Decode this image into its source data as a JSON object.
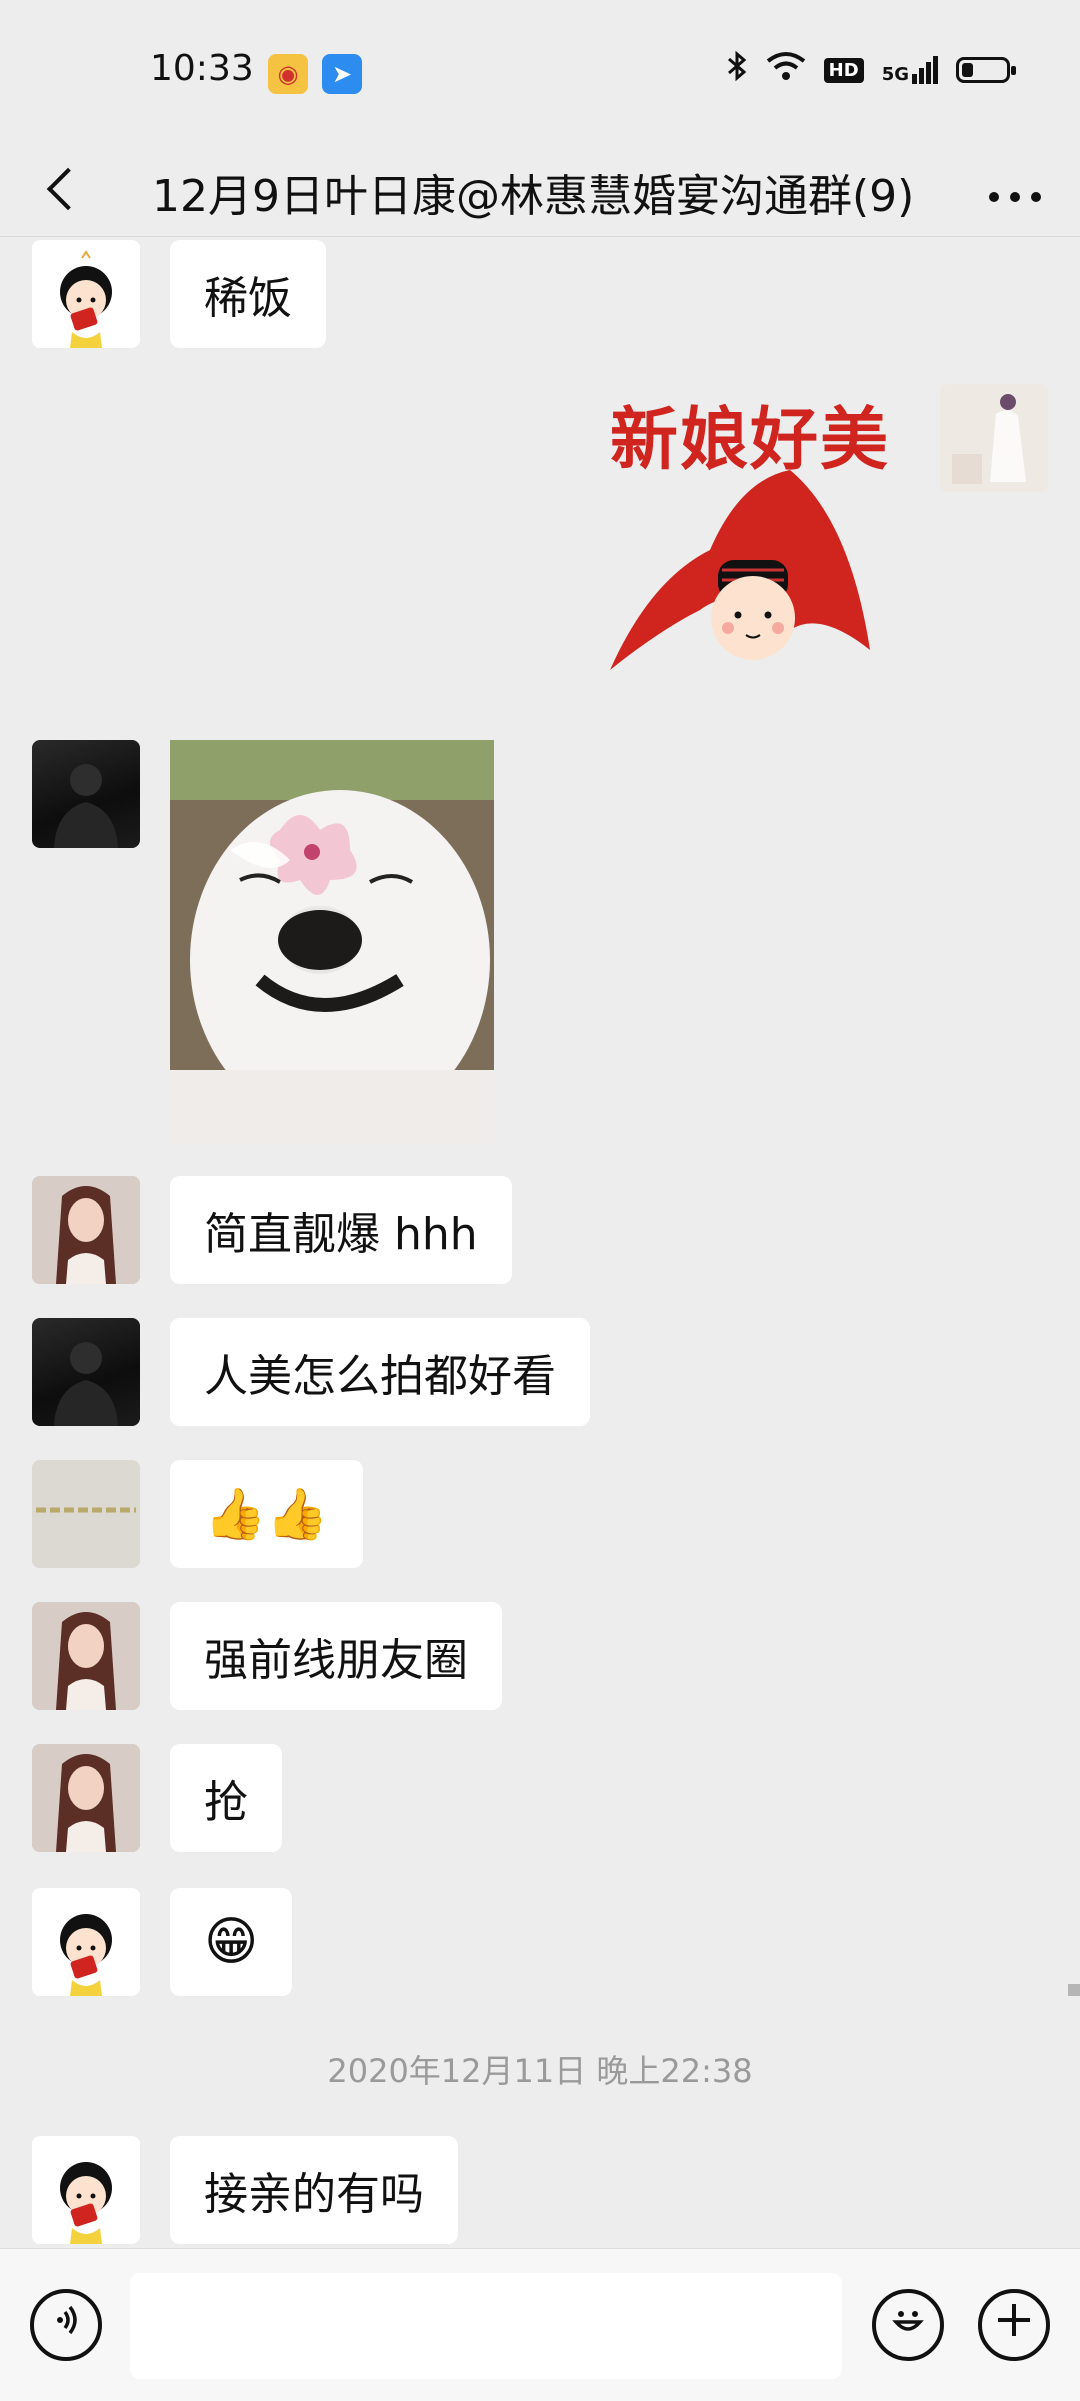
{
  "status_bar": {
    "time": "10:33",
    "icons": [
      "weibo-icon",
      "message-app-icon",
      "bluetooth-icon",
      "wifi-icon",
      "hd-icon",
      "signal-5g-icon",
      "battery-icon"
    ],
    "hd_label": "HD",
    "network_label": "5G",
    "battery_fraction": 0.25
  },
  "nav": {
    "title": "12月9日叶日康@林惠慧婚宴沟通群(9)",
    "back_icon": "back-chevron-icon",
    "more_icon": "more-dots-icon"
  },
  "messages": [
    {
      "type": "text",
      "sender_avatar": "cartoon-girl",
      "text": "稀饭"
    },
    {
      "type": "sticker",
      "sender_avatar": "self",
      "caption": "新娘好美"
    },
    {
      "type": "image",
      "sender_avatar": "dark-man",
      "description_icon": "dog-flower-photo"
    },
    {
      "type": "text",
      "sender_avatar": "woman",
      "text": "简直靓爆 hhh"
    },
    {
      "type": "text",
      "sender_avatar": "dark-man",
      "text": "人美怎么拍都好看"
    },
    {
      "type": "emoji",
      "sender_avatar": "brand",
      "text": "👍👍"
    },
    {
      "type": "text",
      "sender_avatar": "woman",
      "text": "强前线朋友圈"
    },
    {
      "type": "text",
      "sender_avatar": "woman",
      "text": "抢"
    },
    {
      "type": "emoji",
      "sender_avatar": "cartoon-girl",
      "text": "😁"
    },
    {
      "type": "text",
      "sender_avatar": "cartoon-girl",
      "text": "接亲的有吗"
    }
  ],
  "time_divider": "2020年12月11日 晚上22:38",
  "input_bar": {
    "voice_icon": "voice-icon",
    "emoji_icon": "emoji-icon",
    "plus_icon": "plus-icon",
    "placeholder": ""
  },
  "colors": {
    "background": "#ededed",
    "bubble": "#ffffff",
    "sticker_red": "#d0241f"
  }
}
